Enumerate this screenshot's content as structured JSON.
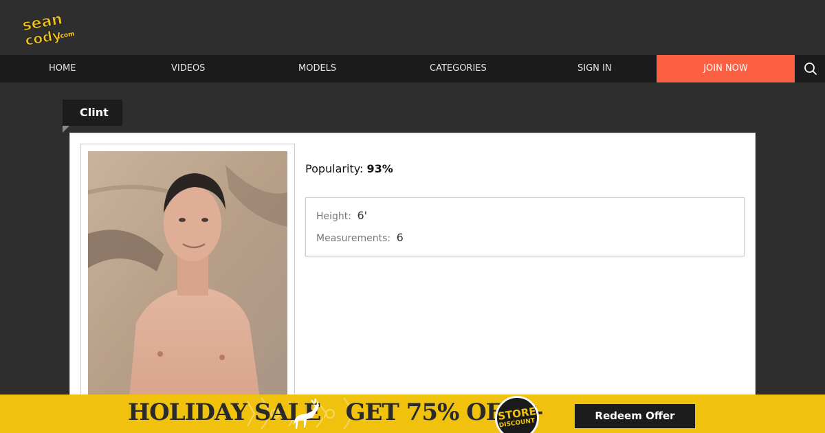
{
  "logo": {
    "text": "sean cody.com"
  },
  "nav": {
    "items": [
      {
        "label": "HOME"
      },
      {
        "label": "VIDEOS"
      },
      {
        "label": "MODELS"
      },
      {
        "label": "CATEGORIES"
      },
      {
        "label": "SIGN IN"
      }
    ],
    "join_label": "JOIN NOW",
    "search_icon": "search-icon"
  },
  "model": {
    "name": "Clint",
    "popularity_label": "Popularity:",
    "popularity_value": "93%",
    "height_label": "Height:",
    "height_value": "6'",
    "measurements_label": "Measurements:",
    "measurements_value": "6"
  },
  "promo": {
    "part1": "HOLIDAY SALE",
    "part2": "GET 75% OFF +",
    "badge_top": "STORE",
    "badge_bottom": "DISCOUNT",
    "button_label": "Redeem Offer"
  },
  "colors": {
    "accent": "#fa6041",
    "promo_bg": "#f0c20e",
    "logo_yellow": "#f5c518"
  }
}
